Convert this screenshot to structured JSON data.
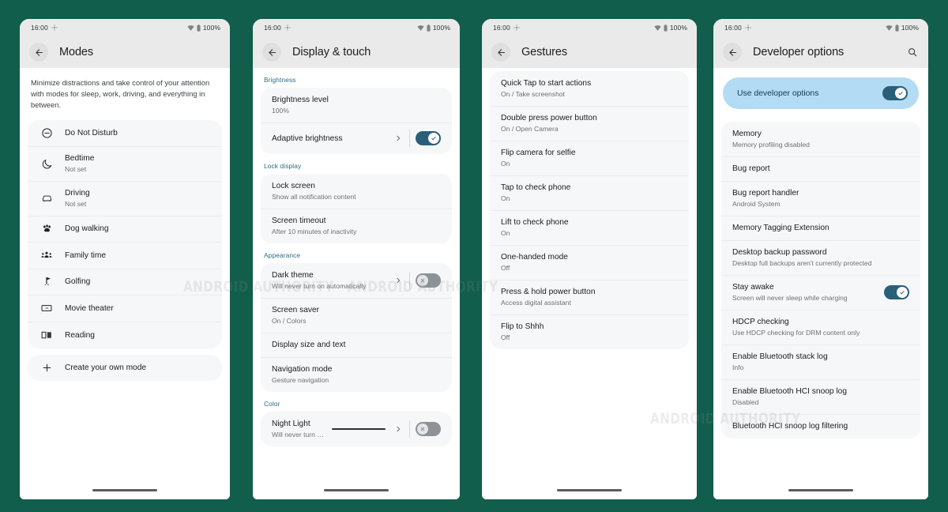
{
  "background_color": "#115e4c",
  "watermark": {
    "text": "ANDROID AUTHORITY",
    "occurrences": 3
  },
  "status_bar": {
    "time": "16:00",
    "battery_percent": "100%",
    "icons": [
      "location-icon",
      "wifi-icon",
      "battery-icon"
    ]
  },
  "phones": [
    {
      "id": "modes",
      "title": "Modes",
      "has_search": false,
      "intro": "Minimize distractions and take control of your attention with modes for sleep, work, driving, and everything in between.",
      "groups": [
        {
          "rows": [
            {
              "icon": "do-not-disturb-icon",
              "title": "Do Not Disturb",
              "sub": ""
            },
            {
              "icon": "moon-icon",
              "title": "Bedtime",
              "sub": "Not set"
            },
            {
              "icon": "car-icon",
              "title": "Driving",
              "sub": "Not set"
            },
            {
              "icon": "paw-icon",
              "title": "Dog walking",
              "sub": ""
            },
            {
              "icon": "people-icon",
              "title": "Family time",
              "sub": ""
            },
            {
              "icon": "golf-icon",
              "title": "Golfing",
              "sub": ""
            },
            {
              "icon": "ticket-icon",
              "title": "Movie theater",
              "sub": ""
            },
            {
              "icon": "book-icon",
              "title": "Reading",
              "sub": ""
            }
          ]
        },
        {
          "rows": [
            {
              "icon": "plus-icon",
              "title": "Create your own mode",
              "sub": ""
            }
          ]
        }
      ]
    },
    {
      "id": "display-and-touch",
      "title": "Display & touch",
      "has_search": false,
      "sections": [
        {
          "label": "Brightness",
          "rows": [
            {
              "title": "Brightness level",
              "sub": "100%"
            },
            {
              "title": "Adaptive brightness",
              "sub": "",
              "chevron": true,
              "toggle": "on"
            }
          ]
        },
        {
          "label": "Lock display",
          "rows": [
            {
              "title": "Lock screen",
              "sub": "Show all notification content"
            },
            {
              "title": "Screen timeout",
              "sub": "After 10 minutes of inactivity"
            }
          ]
        },
        {
          "label": "Appearance",
          "rows": [
            {
              "title": "Dark theme",
              "sub": "Will never turn on automatically",
              "chevron": true,
              "toggle": "off"
            },
            {
              "title": "Screen saver",
              "sub": "On / Colors"
            },
            {
              "title": "Display size and text",
              "sub": ""
            },
            {
              "title": "Navigation mode",
              "sub": "Gesture navigation"
            }
          ]
        },
        {
          "label": "Color",
          "rows": [
            {
              "title": "Night Light",
              "sub": "Will never turn on automatically",
              "slider": true,
              "chevron": true,
              "toggle": "off"
            }
          ]
        }
      ]
    },
    {
      "id": "gestures",
      "title": "Gestures",
      "has_search": false,
      "groups": [
        {
          "rows": [
            {
              "title": "Quick Tap to start actions",
              "sub": "On / Take screenshot"
            },
            {
              "title": "Double press power button",
              "sub": "On / Open Camera"
            },
            {
              "title": "Flip camera for selfie",
              "sub": "On"
            },
            {
              "title": "Tap to check phone",
              "sub": "On"
            },
            {
              "title": "Lift to check phone",
              "sub": "On"
            },
            {
              "title": "One-handed mode",
              "sub": "Off"
            },
            {
              "title": "Press & hold power button",
              "sub": "Access digital assistant"
            },
            {
              "title": "Flip to Shhh",
              "sub": "Off"
            }
          ]
        }
      ]
    },
    {
      "id": "developer-options",
      "title": "Developer options",
      "has_search": true,
      "highlight_row": {
        "title": "Use developer options",
        "toggle": "on"
      },
      "groups": [
        {
          "rows": [
            {
              "title": "Memory",
              "sub": "Memory profiling disabled"
            },
            {
              "title": "Bug report",
              "sub": ""
            },
            {
              "title": "Bug report handler",
              "sub": "Android System"
            },
            {
              "title": "Memory Tagging Extension",
              "sub": ""
            },
            {
              "title": "Desktop backup password",
              "sub": "Desktop full backups aren't currently protected"
            },
            {
              "title": "Stay awake",
              "sub": "Screen will never sleep while charging",
              "toggle": "on"
            },
            {
              "title": "HDCP checking",
              "sub": "Use HDCP checking for DRM content only"
            },
            {
              "title": "Enable Bluetooth stack log",
              "sub": "Info"
            },
            {
              "title": "Enable Bluetooth HCI snoop log",
              "sub": "Disabled"
            },
            {
              "title": "Bluetooth HCI snoop log filtering",
              "sub": ""
            }
          ]
        }
      ]
    }
  ]
}
